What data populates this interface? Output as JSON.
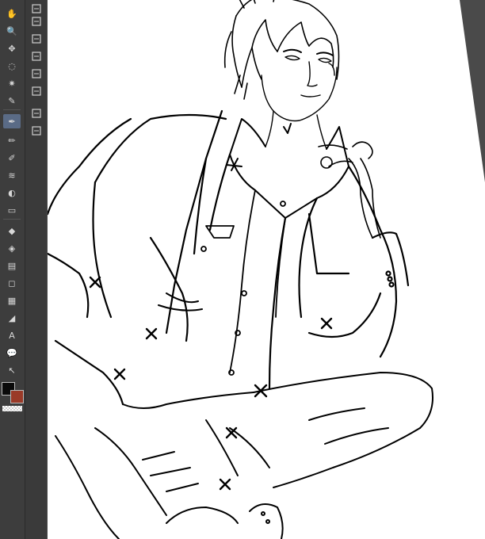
{
  "app": {
    "name": ""
  },
  "toolbar": {
    "tools": [
      {
        "name": "hand-icon",
        "glyph": "✋"
      },
      {
        "name": "zoom-icon",
        "glyph": "🔍"
      },
      {
        "name": "move-icon",
        "glyph": "✥"
      },
      {
        "name": "lasso-icon",
        "glyph": "◌"
      },
      {
        "name": "magic-wand-icon",
        "glyph": "✷"
      },
      {
        "name": "eyedropper-icon",
        "glyph": "✎"
      },
      {
        "name": "pen-icon",
        "glyph": "✒",
        "active": true
      },
      {
        "name": "pencil-icon",
        "glyph": "✏"
      },
      {
        "name": "brush-icon",
        "glyph": "✐"
      },
      {
        "name": "airbrush-icon",
        "glyph": "≋"
      },
      {
        "name": "blend-icon",
        "glyph": "◐"
      },
      {
        "name": "eraser-icon",
        "glyph": "▭"
      },
      {
        "name": "fill-icon",
        "glyph": "◆"
      },
      {
        "name": "bucket-icon",
        "glyph": "◈"
      },
      {
        "name": "gradient-icon",
        "glyph": "▤"
      },
      {
        "name": "figure-icon",
        "glyph": "◻"
      },
      {
        "name": "frame-icon",
        "glyph": "▦"
      },
      {
        "name": "ruler-icon",
        "glyph": "◢"
      },
      {
        "name": "text-icon",
        "glyph": "A"
      },
      {
        "name": "balloon-icon",
        "glyph": "💬"
      },
      {
        "name": "operation-icon",
        "glyph": "↖"
      }
    ],
    "text_tool_label": "A"
  },
  "sub_toolbar": {
    "items": [
      {
        "name": "layer-add-icon"
      },
      {
        "name": "layer-fill-icon"
      },
      {
        "name": "layer-mask-icon"
      },
      {
        "name": "layer-color-icon"
      },
      {
        "name": "layer-ref-icon"
      },
      {
        "name": "layer-stack-icon"
      },
      {
        "name": "layer-stack-2-icon"
      },
      {
        "name": "layer-export-icon"
      }
    ]
  },
  "colors": {
    "foreground": "#0a0a0a",
    "background": "#9a3a28",
    "panel_bg": "#3d3d3d",
    "active_tool": "#5a6b86",
    "canvas_bg": "#ffffff",
    "line": "#000000"
  }
}
